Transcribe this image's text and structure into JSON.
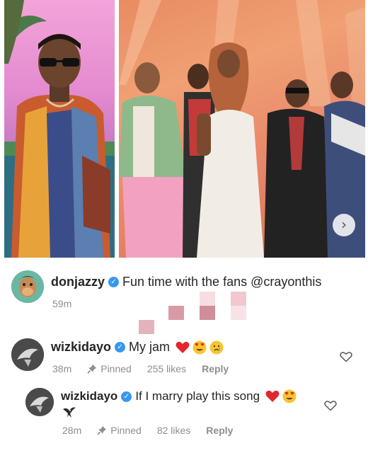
{
  "post": {
    "carousel_next_glyph": "›"
  },
  "caption": {
    "username": "donjazzy",
    "verified": true,
    "text": "Fun time with the fans @crayonthis",
    "time": "59m"
  },
  "comments": [
    {
      "username": "wizkidayo",
      "verified": true,
      "text": "My jam",
      "emojis": [
        "red-heart",
        "heart-eyes-face",
        "crying-face"
      ],
      "time": "38m",
      "pinned_label": "Pinned",
      "likes": "255 likes",
      "reply_label": "Reply"
    },
    {
      "username": "wizkidayo",
      "verified": true,
      "text": "If I marry play this song",
      "emojis": [
        "red-heart",
        "heart-eyes-face",
        "eagle"
      ],
      "time": "28m",
      "pinned_label": "Pinned",
      "likes": "82 likes",
      "reply_label": "Reply"
    }
  ],
  "colors": {
    "verified": "#3897f0",
    "muted": "#8e8e8e",
    "heart": "#e3262e"
  }
}
